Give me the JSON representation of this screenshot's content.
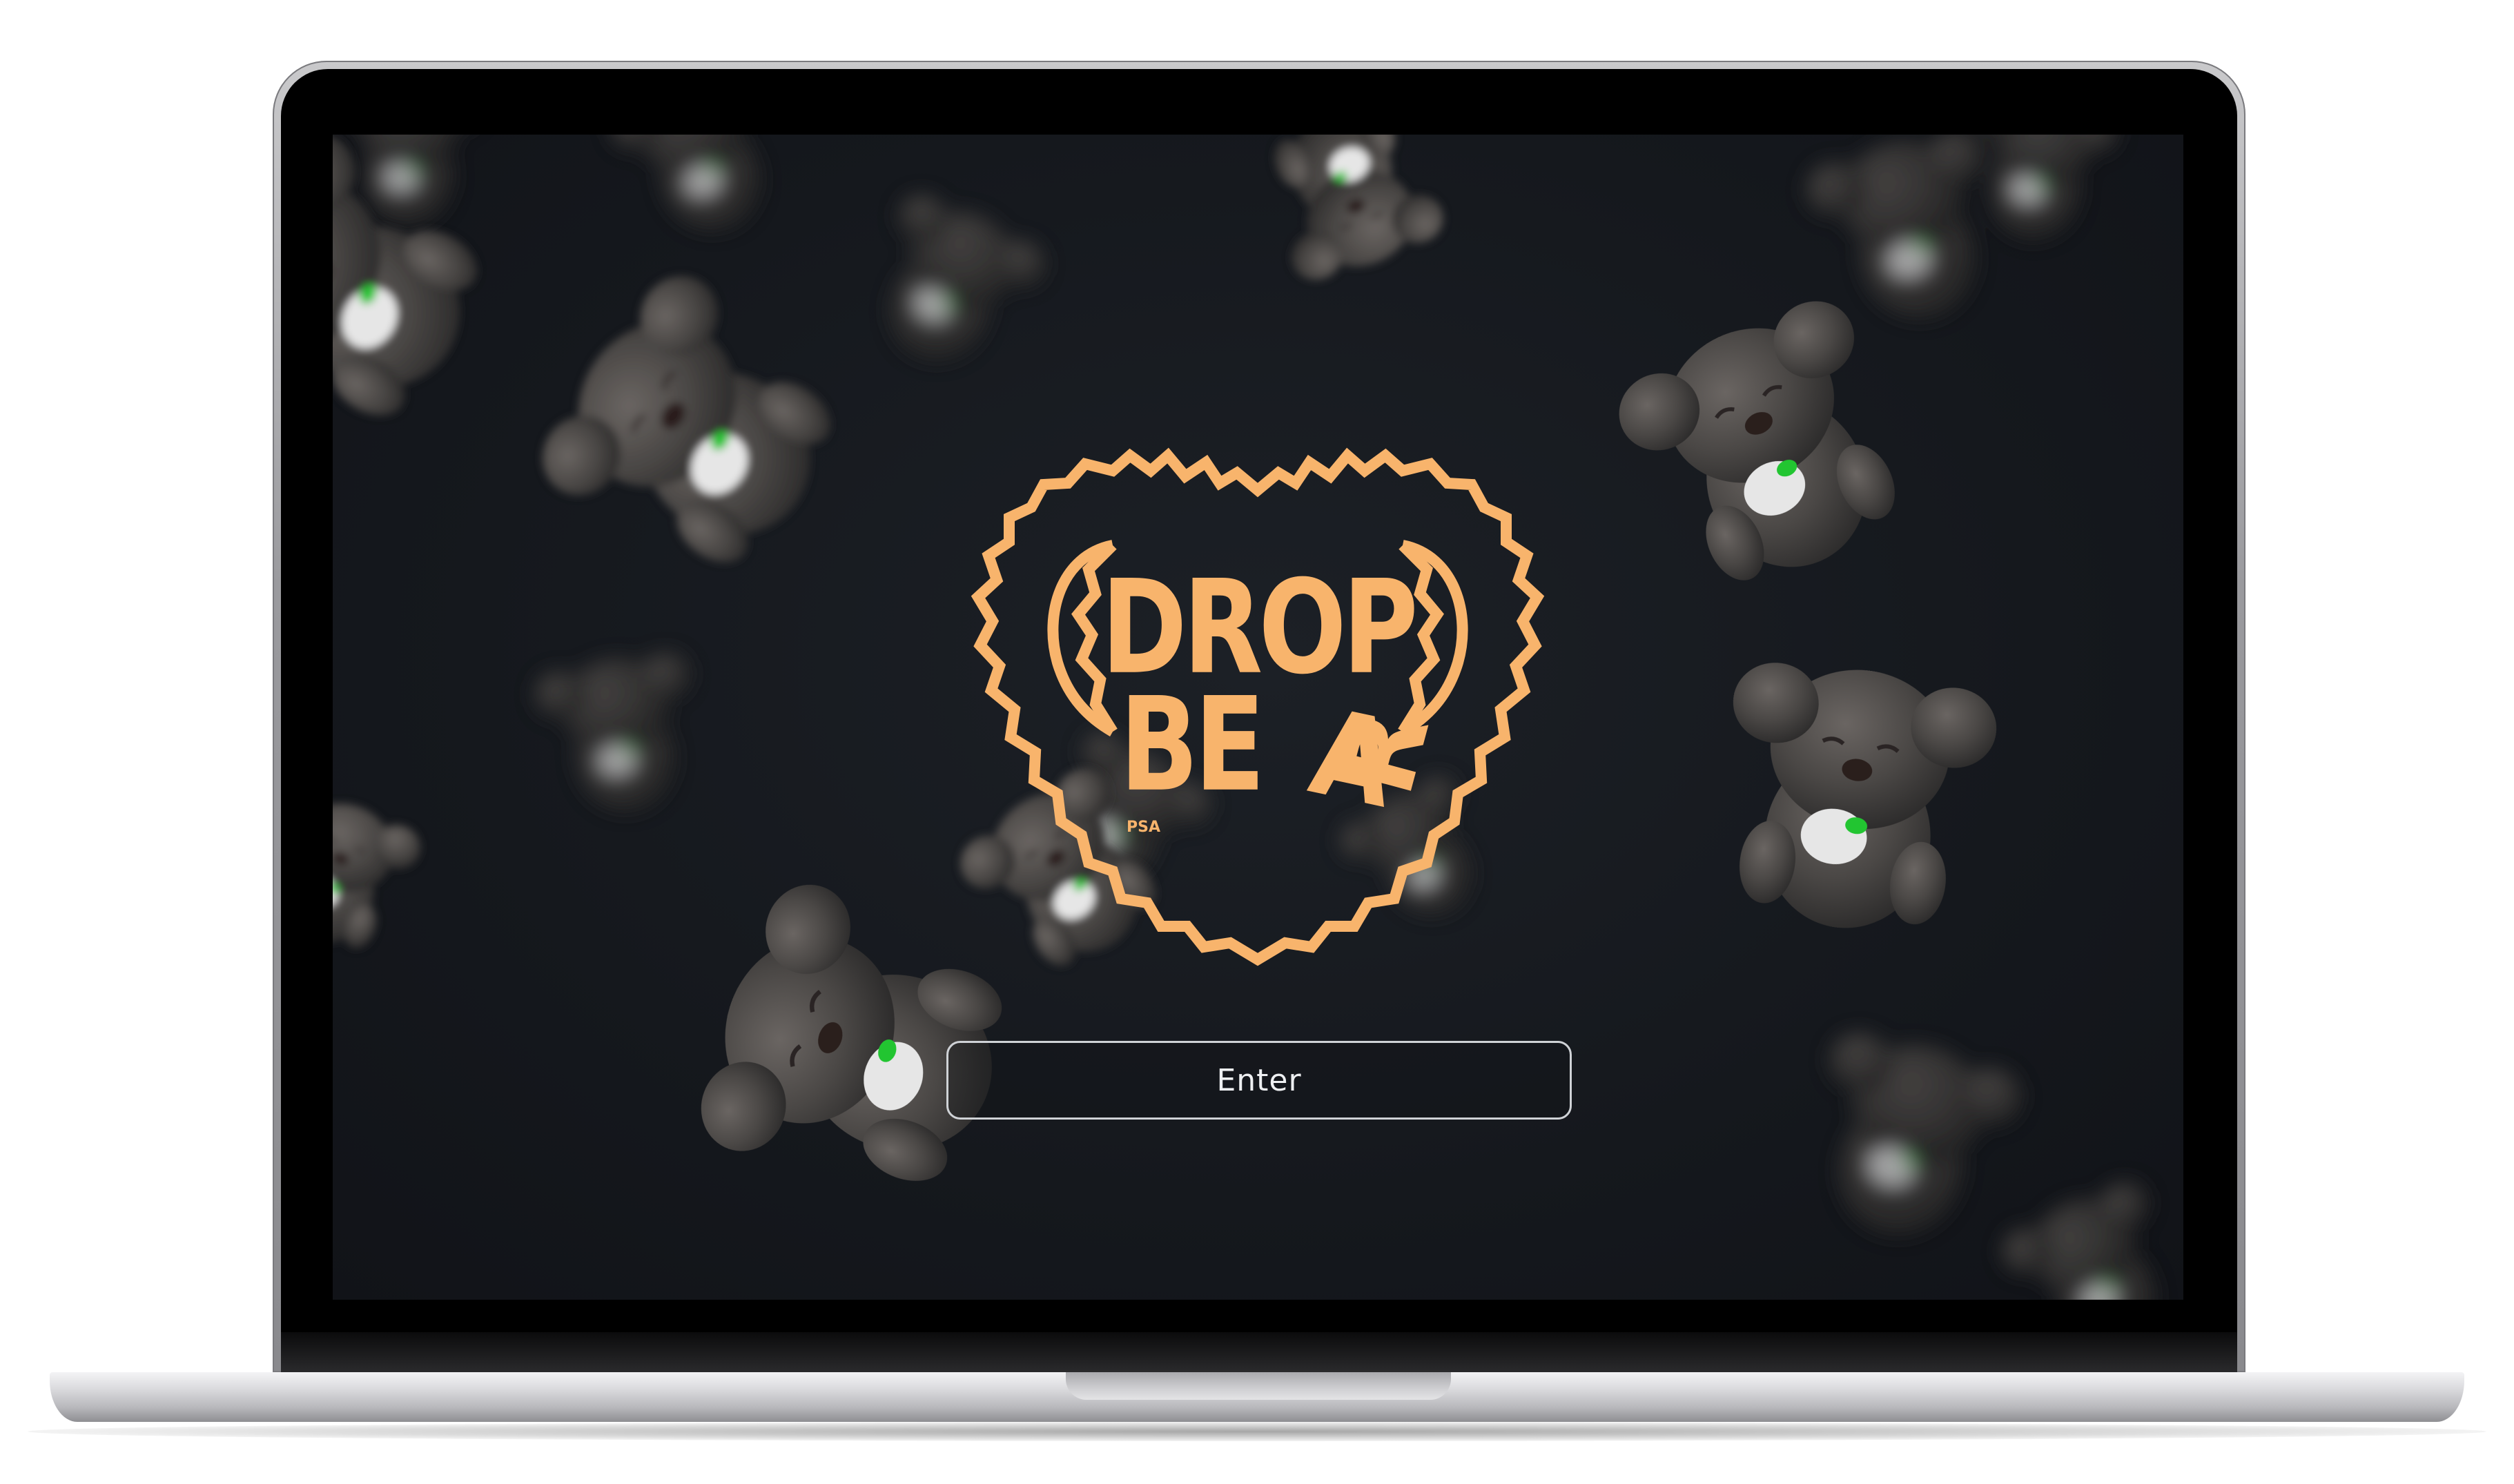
{
  "page": {
    "title": "DROP BEAR"
  },
  "logo": {
    "line1": "DROP",
    "line2_a": "BE",
    "line2_b": "A",
    "line2_c": "R",
    "tag": "PSA",
    "color": "#f8b46c"
  },
  "enter_button": {
    "label": "Enter"
  },
  "colors": {
    "screen_bg": "#15181d",
    "bear_body": "#4a4745",
    "accent_green": "#22c531",
    "button_border": "#cfd2d6"
  },
  "icons": {
    "logo": "koala-head-logo"
  }
}
